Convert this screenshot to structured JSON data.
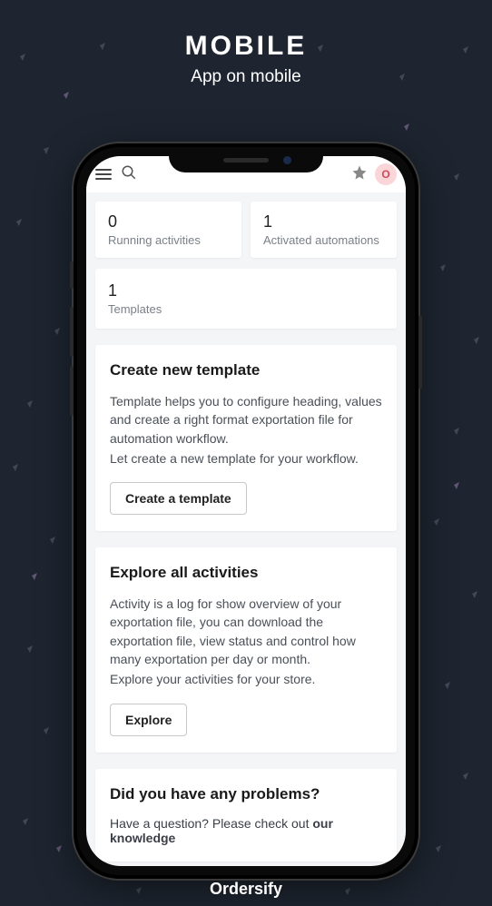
{
  "header": {
    "title": "MOBILE",
    "subtitle": "App on mobile"
  },
  "footer": {
    "brand": "Ordersify"
  },
  "topbar": {
    "user_badge": "O"
  },
  "stats": {
    "running": {
      "value": "0",
      "label": "Running activities"
    },
    "automations": {
      "value": "1",
      "label": "Activated automations"
    },
    "templates": {
      "value": "1",
      "label": "Templates"
    }
  },
  "create_template": {
    "title": "Create new template",
    "body1": "Template helps you to configure heading, values and create a right format exportation file for automation workflow.",
    "body2": "Let create a new template for your workflow.",
    "button": "Create a template"
  },
  "explore": {
    "title": "Explore all activities",
    "body1": "Activity is a log for show overview of your exportation file, you can download the exportation file, view status and control how many exportation per day or month.",
    "body2": "Explore your activities for your store.",
    "button": "Explore"
  },
  "help": {
    "title": "Did you have any problems?",
    "body_prefix": "Have a question? Please check out ",
    "body_bold": "our knowledge"
  }
}
